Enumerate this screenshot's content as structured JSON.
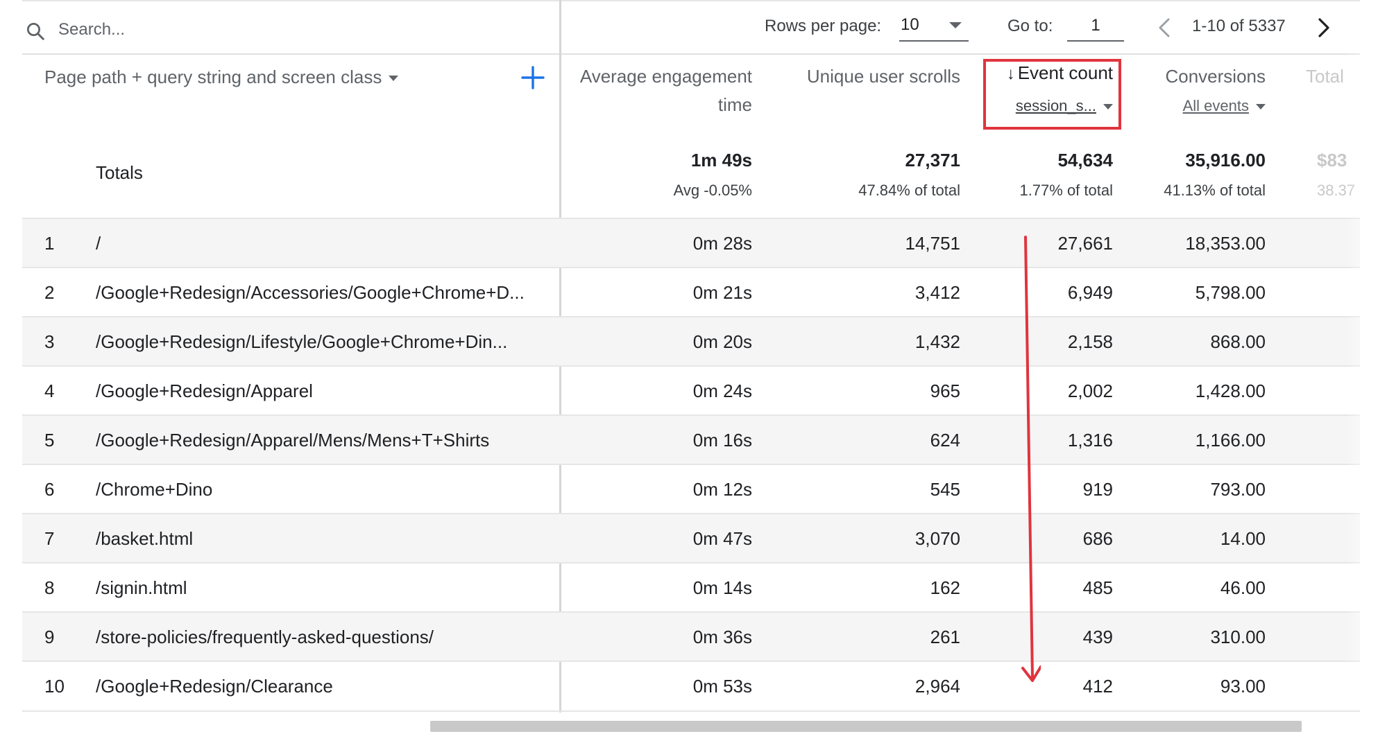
{
  "toolbar": {
    "search_placeholder": "Search...",
    "rows_per_page_label": "Rows per page:",
    "rows_per_page_value": "10",
    "goto_label": "Go to:",
    "goto_value": "1",
    "page_range": "1-10 of 5337"
  },
  "icons": {
    "search": "search-icon",
    "add": "plus-icon",
    "prev": "chevron-left-icon",
    "next": "chevron-right-icon",
    "sort": "arrow-down-icon"
  },
  "colors": {
    "accent": "#1a73e8",
    "highlight": "#e0343e",
    "annotation_arrow": "#e0343e"
  },
  "table": {
    "dimension_header": "Page path + query string and screen class",
    "columns": [
      {
        "label": "Average engagement time"
      },
      {
        "label": "Unique user scrolls"
      },
      {
        "label": "Event count",
        "sort": "descending",
        "subfilter": "session_s..."
      },
      {
        "label": "Conversions",
        "subfilter": "All events"
      },
      {
        "label": "Total"
      }
    ],
    "totals": {
      "label": "Totals",
      "values": [
        "1m 49s",
        "27,371",
        "54,634",
        "35,916.00",
        "$83"
      ],
      "subs": [
        "Avg -0.05%",
        "47.84% of total",
        "1.77% of total",
        "41.13% of total",
        "38.37"
      ]
    },
    "rows": [
      {
        "n": "1",
        "path": "/",
        "avg": "0m 28s",
        "scrolls": "14,751",
        "events": "27,661",
        "conv": "18,353.00"
      },
      {
        "n": "2",
        "path": "/Google+Redesign/Accessories/Google+Chrome+D...",
        "avg": "0m 21s",
        "scrolls": "3,412",
        "events": "6,949",
        "conv": "5,798.00"
      },
      {
        "n": "3",
        "path": "/Google+Redesign/Lifestyle/Google+Chrome+Din...",
        "avg": "0m 20s",
        "scrolls": "1,432",
        "events": "2,158",
        "conv": "868.00"
      },
      {
        "n": "4",
        "path": "/Google+Redesign/Apparel",
        "avg": "0m 24s",
        "scrolls": "965",
        "events": "2,002",
        "conv": "1,428.00"
      },
      {
        "n": "5",
        "path": "/Google+Redesign/Apparel/Mens/Mens+T+Shirts",
        "avg": "0m 16s",
        "scrolls": "624",
        "events": "1,316",
        "conv": "1,166.00"
      },
      {
        "n": "6",
        "path": "/Chrome+Dino",
        "avg": "0m 12s",
        "scrolls": "545",
        "events": "919",
        "conv": "793.00"
      },
      {
        "n": "7",
        "path": "/basket.html",
        "avg": "0m 47s",
        "scrolls": "3,070",
        "events": "686",
        "conv": "14.00"
      },
      {
        "n": "8",
        "path": "/signin.html",
        "avg": "0m 14s",
        "scrolls": "162",
        "events": "485",
        "conv": "46.00"
      },
      {
        "n": "9",
        "path": "/store-policies/frequently-asked-questions/",
        "avg": "0m 36s",
        "scrolls": "261",
        "events": "439",
        "conv": "310.00"
      },
      {
        "n": "10",
        "path": "/Google+Redesign/Clearance",
        "avg": "0m 53s",
        "scrolls": "2,964",
        "events": "412",
        "conv": "93.00"
      }
    ]
  }
}
